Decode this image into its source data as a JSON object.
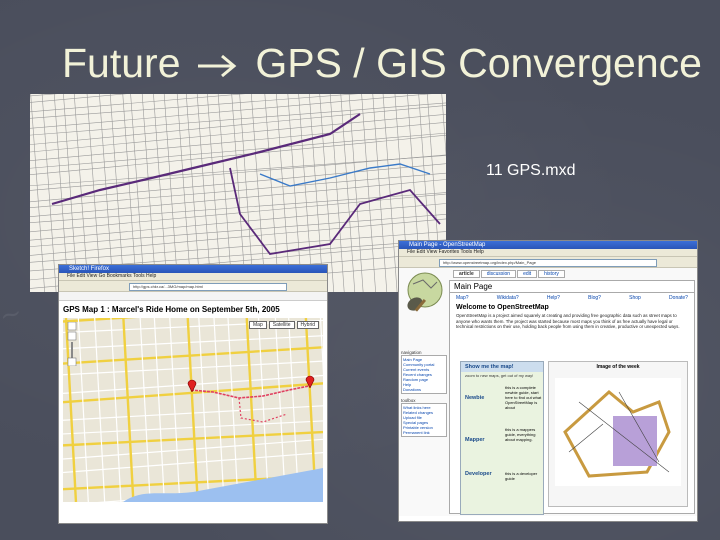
{
  "slide": {
    "title_prefix": "Future",
    "title_suffix": "GPS / GIS Convergence",
    "caption": "11 GPS.mxd"
  },
  "colors": {
    "background": "#4a4e5c",
    "title": "#f2f2d8",
    "route_primary": "#5a2a7a",
    "route_secondary": "#3a7ac8",
    "gmap_route": "#e04060"
  },
  "gmaps": {
    "window_title": "Sketch! Firefox",
    "menu": "File  Edit  View  Go  Bookmarks  Tools  Help",
    "address": "http://gps.chkr.ca/...3MG/map/map.html",
    "heading": "GPS Map 1 : Marcel's Ride Home on September 5th, 2005",
    "buttons": [
      "Map",
      "Satellite",
      "Hybrid"
    ]
  },
  "osm": {
    "window_title": "Main Page - OpenStreetMap",
    "menu": "File  Edit  View  Favorites  Tools  Help",
    "address": "http://www.openstreetmap.org/index.php/Main_Page",
    "tabs": [
      "article",
      "discussion",
      "edit",
      "history"
    ],
    "page_title": "Main Page",
    "nav_links": [
      "Map?",
      "Wikidata?",
      "Help?",
      "Blog?",
      "Shop",
      "Donate?"
    ],
    "welcome": "Welcome to OpenStreetMap",
    "intro": "OpenStreetMap is a project aimed squarely at creating and providing free geographic data such as street maps to anyone who wants them. The project was started because most maps you think of as free actually have legal or technical restrictions on their use, holding back people from using them in creative, productive or unexpected ways.",
    "sidebar_nav_title": "navigation",
    "sidebar_nav": [
      "Main Page",
      "Community portal",
      "Current events",
      "Recent changes",
      "Random page",
      "Help",
      "Donations"
    ],
    "sidebar_tools_title": "toolbox",
    "sidebar_tools": [
      "What links here",
      "Related changes",
      "Upload file",
      "Special pages",
      "Printable version",
      "Permanent link"
    ],
    "show_map": "Show me the map!",
    "show_map_sub": "zoom to new maps, get out of my way!",
    "roles": [
      "Newbie",
      "Mapper",
      "Developer"
    ],
    "role_texts": [
      "this is a complete newbie guide, start here to find out what OpenStreetMap is about",
      "this is a mappers guide, everything about mapping.",
      "this is a developer guide"
    ],
    "image_of_week": "Image of the week"
  }
}
